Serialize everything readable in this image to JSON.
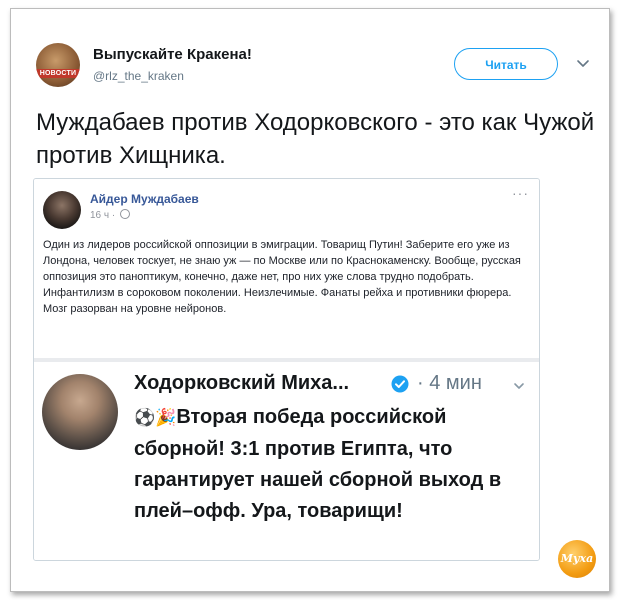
{
  "tweet": {
    "author_name": "Выпускайте Кракена!",
    "author_handle": "@rlz_the_kraken",
    "avatar_label": "НОВОСТИ",
    "follow_label": "Читать",
    "text": "Муждабаев против Ходорковского - это как Чужой против Хищника."
  },
  "facebook_post": {
    "author": "Айдер Муждабаев",
    "time": "16 ч ·",
    "more_label": "···",
    "text": "Один из лидеров российской оппозиции в эмиграции. Товарищ Путин! Заберите его уже из Лондона, человек тоскует, не знаю уж — по Москве или по Краснокаменску. Вообще, русская оппозиция это паноптикум, конечно, даже нет, про них уже слова трудно подобрать. Инфантилизм в сороковом поколении. Неизлечимые. Фанаты рейха и противники фюрера. Мозг разорван на уровне нейронов."
  },
  "inner_tweet": {
    "author": "Ходорковский Миха...",
    "time": "· 4 мин",
    "emojis": "⚽🎉",
    "text": "Вторая победа российской сборной! 3:1 против Египта, что гарантирует нашей сборной выход в плей–офф. Ура, товарищи!"
  },
  "watermark": {
    "label": "Муха"
  },
  "icons": {
    "follow_chevron": "chevron-down-icon",
    "verified": "verified-badge-icon",
    "globe": "globe-icon"
  },
  "colors": {
    "twitter_blue": "#1da1f2",
    "facebook_link": "#385898",
    "text_dark": "#14171a",
    "text_muted": "#657786"
  }
}
